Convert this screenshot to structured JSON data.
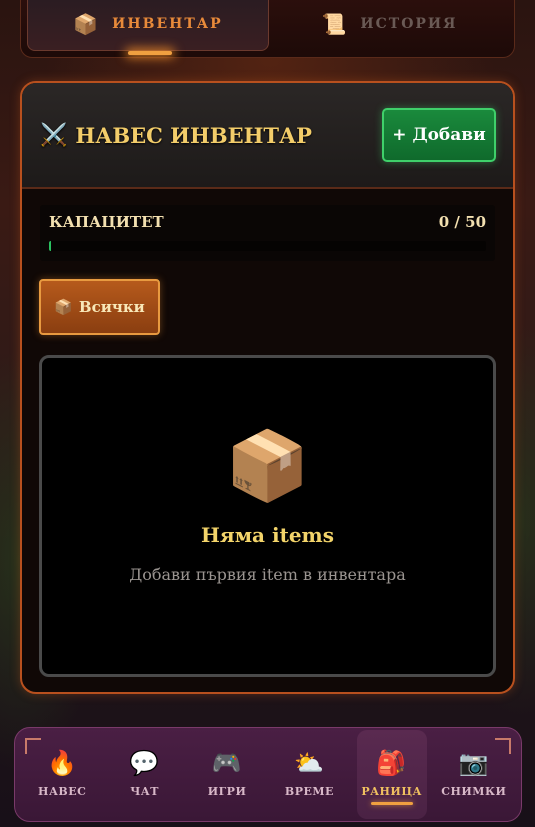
{
  "top_tabs": [
    {
      "label": "ИНВЕНТАР",
      "icon": "📦",
      "icon_name": "box-icon",
      "active": true
    },
    {
      "label": "ИСТОРИЯ",
      "icon": "📜",
      "icon_name": "scroll-icon",
      "active": false
    }
  ],
  "panel": {
    "title_icon": "⚔️",
    "title": "НАВЕС ИНВЕНТАР",
    "add_label": "+ Добави"
  },
  "capacity": {
    "label": "КАПАЦИТЕТ",
    "value": "0 / 50",
    "fraction": 0.0
  },
  "filter": {
    "icon": "📦",
    "label": "Всички"
  },
  "empty_state": {
    "icon": "📦",
    "title": "Няма items",
    "subtitle": "Добави първия item в инвентара"
  },
  "nav": [
    {
      "label": "НАВЕС",
      "icon": "🔥",
      "icon_name": "campfire-icon"
    },
    {
      "label": "ЧАТ",
      "icon": "💬",
      "icon_name": "chat-icon"
    },
    {
      "label": "ИГРИ",
      "icon": "🎮",
      "icon_name": "gamepad-icon"
    },
    {
      "label": "ВРЕМЕ",
      "icon": "⛅",
      "icon_name": "weather-icon"
    },
    {
      "label": "РАНИЦА",
      "icon": "🎒",
      "icon_name": "backpack-icon",
      "active": true
    },
    {
      "label": "СНИМКИ",
      "icon": "📷",
      "icon_name": "camera-icon"
    }
  ],
  "colors": {
    "accent_orange": "#e88a3a",
    "title_gold": "#f3cd6a",
    "add_green": "#1a8a3c",
    "panel_border": "#b8501e",
    "nav_purple": "#4a1f44"
  }
}
